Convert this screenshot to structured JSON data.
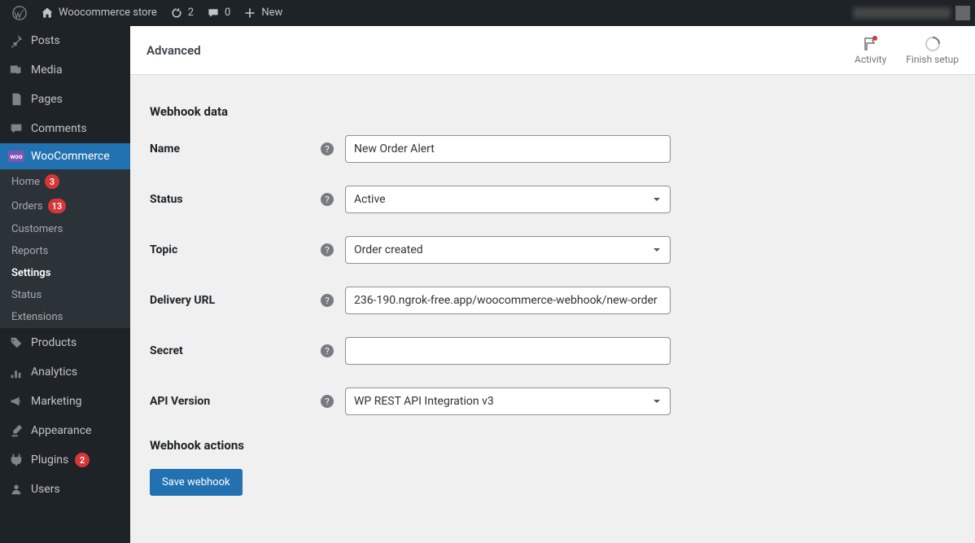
{
  "adminbar": {
    "site_name": "Woocommerce store",
    "updates_count": "2",
    "comments_count": "0",
    "new_label": "New"
  },
  "sidebar": {
    "items": [
      {
        "label": "Posts"
      },
      {
        "label": "Media"
      },
      {
        "label": "Pages"
      },
      {
        "label": "Comments"
      },
      {
        "label": "WooCommerce"
      },
      {
        "label": "Products"
      },
      {
        "label": "Analytics"
      },
      {
        "label": "Marketing"
      },
      {
        "label": "Appearance"
      },
      {
        "label": "Plugins",
        "badge": "2"
      },
      {
        "label": "Users"
      }
    ],
    "woo_sub": [
      {
        "label": "Home",
        "badge": "3"
      },
      {
        "label": "Orders",
        "badge": "13"
      },
      {
        "label": "Customers"
      },
      {
        "label": "Reports"
      },
      {
        "label": "Settings",
        "active": true
      },
      {
        "label": "Status"
      },
      {
        "label": "Extensions"
      }
    ]
  },
  "header": {
    "title": "Advanced",
    "activity_label": "Activity",
    "finish_label": "Finish setup"
  },
  "form": {
    "section_title": "Webhook data",
    "name": {
      "label": "Name",
      "value": "New Order Alert"
    },
    "status": {
      "label": "Status",
      "value": "Active"
    },
    "topic": {
      "label": "Topic",
      "value": "Order created"
    },
    "delivery_url": {
      "label": "Delivery URL",
      "value": "236-190.ngrok-free.app/woocommerce-webhook/new-order"
    },
    "secret": {
      "label": "Secret",
      "value": ""
    },
    "api_version": {
      "label": "API Version",
      "value": "WP REST API Integration v3"
    },
    "actions_title": "Webhook actions",
    "save_label": "Save webhook"
  }
}
